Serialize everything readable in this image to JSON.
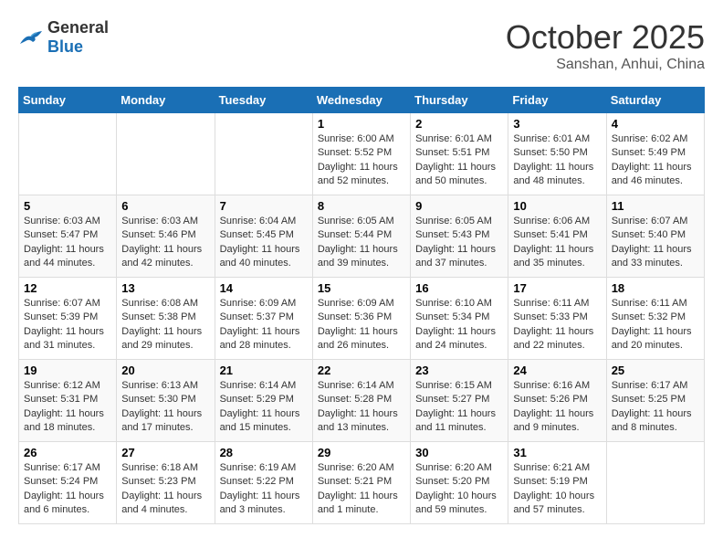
{
  "header": {
    "logo_general": "General",
    "logo_blue": "Blue",
    "month": "October 2025",
    "location": "Sanshan, Anhui, China"
  },
  "weekdays": [
    "Sunday",
    "Monday",
    "Tuesday",
    "Wednesday",
    "Thursday",
    "Friday",
    "Saturday"
  ],
  "weeks": [
    [
      {
        "day": "",
        "info": ""
      },
      {
        "day": "",
        "info": ""
      },
      {
        "day": "",
        "info": ""
      },
      {
        "day": "1",
        "info": "Sunrise: 6:00 AM\nSunset: 5:52 PM\nDaylight: 11 hours\nand 52 minutes."
      },
      {
        "day": "2",
        "info": "Sunrise: 6:01 AM\nSunset: 5:51 PM\nDaylight: 11 hours\nand 50 minutes."
      },
      {
        "day": "3",
        "info": "Sunrise: 6:01 AM\nSunset: 5:50 PM\nDaylight: 11 hours\nand 48 minutes."
      },
      {
        "day": "4",
        "info": "Sunrise: 6:02 AM\nSunset: 5:49 PM\nDaylight: 11 hours\nand 46 minutes."
      }
    ],
    [
      {
        "day": "5",
        "info": "Sunrise: 6:03 AM\nSunset: 5:47 PM\nDaylight: 11 hours\nand 44 minutes."
      },
      {
        "day": "6",
        "info": "Sunrise: 6:03 AM\nSunset: 5:46 PM\nDaylight: 11 hours\nand 42 minutes."
      },
      {
        "day": "7",
        "info": "Sunrise: 6:04 AM\nSunset: 5:45 PM\nDaylight: 11 hours\nand 40 minutes."
      },
      {
        "day": "8",
        "info": "Sunrise: 6:05 AM\nSunset: 5:44 PM\nDaylight: 11 hours\nand 39 minutes."
      },
      {
        "day": "9",
        "info": "Sunrise: 6:05 AM\nSunset: 5:43 PM\nDaylight: 11 hours\nand 37 minutes."
      },
      {
        "day": "10",
        "info": "Sunrise: 6:06 AM\nSunset: 5:41 PM\nDaylight: 11 hours\nand 35 minutes."
      },
      {
        "day": "11",
        "info": "Sunrise: 6:07 AM\nSunset: 5:40 PM\nDaylight: 11 hours\nand 33 minutes."
      }
    ],
    [
      {
        "day": "12",
        "info": "Sunrise: 6:07 AM\nSunset: 5:39 PM\nDaylight: 11 hours\nand 31 minutes."
      },
      {
        "day": "13",
        "info": "Sunrise: 6:08 AM\nSunset: 5:38 PM\nDaylight: 11 hours\nand 29 minutes."
      },
      {
        "day": "14",
        "info": "Sunrise: 6:09 AM\nSunset: 5:37 PM\nDaylight: 11 hours\nand 28 minutes."
      },
      {
        "day": "15",
        "info": "Sunrise: 6:09 AM\nSunset: 5:36 PM\nDaylight: 11 hours\nand 26 minutes."
      },
      {
        "day": "16",
        "info": "Sunrise: 6:10 AM\nSunset: 5:34 PM\nDaylight: 11 hours\nand 24 minutes."
      },
      {
        "day": "17",
        "info": "Sunrise: 6:11 AM\nSunset: 5:33 PM\nDaylight: 11 hours\nand 22 minutes."
      },
      {
        "day": "18",
        "info": "Sunrise: 6:11 AM\nSunset: 5:32 PM\nDaylight: 11 hours\nand 20 minutes."
      }
    ],
    [
      {
        "day": "19",
        "info": "Sunrise: 6:12 AM\nSunset: 5:31 PM\nDaylight: 11 hours\nand 18 minutes."
      },
      {
        "day": "20",
        "info": "Sunrise: 6:13 AM\nSunset: 5:30 PM\nDaylight: 11 hours\nand 17 minutes."
      },
      {
        "day": "21",
        "info": "Sunrise: 6:14 AM\nSunset: 5:29 PM\nDaylight: 11 hours\nand 15 minutes."
      },
      {
        "day": "22",
        "info": "Sunrise: 6:14 AM\nSunset: 5:28 PM\nDaylight: 11 hours\nand 13 minutes."
      },
      {
        "day": "23",
        "info": "Sunrise: 6:15 AM\nSunset: 5:27 PM\nDaylight: 11 hours\nand 11 minutes."
      },
      {
        "day": "24",
        "info": "Sunrise: 6:16 AM\nSunset: 5:26 PM\nDaylight: 11 hours\nand 9 minutes."
      },
      {
        "day": "25",
        "info": "Sunrise: 6:17 AM\nSunset: 5:25 PM\nDaylight: 11 hours\nand 8 minutes."
      }
    ],
    [
      {
        "day": "26",
        "info": "Sunrise: 6:17 AM\nSunset: 5:24 PM\nDaylight: 11 hours\nand 6 minutes."
      },
      {
        "day": "27",
        "info": "Sunrise: 6:18 AM\nSunset: 5:23 PM\nDaylight: 11 hours\nand 4 minutes."
      },
      {
        "day": "28",
        "info": "Sunrise: 6:19 AM\nSunset: 5:22 PM\nDaylight: 11 hours\nand 3 minutes."
      },
      {
        "day": "29",
        "info": "Sunrise: 6:20 AM\nSunset: 5:21 PM\nDaylight: 11 hours\nand 1 minute."
      },
      {
        "day": "30",
        "info": "Sunrise: 6:20 AM\nSunset: 5:20 PM\nDaylight: 10 hours\nand 59 minutes."
      },
      {
        "day": "31",
        "info": "Sunrise: 6:21 AM\nSunset: 5:19 PM\nDaylight: 10 hours\nand 57 minutes."
      },
      {
        "day": "",
        "info": ""
      }
    ]
  ]
}
